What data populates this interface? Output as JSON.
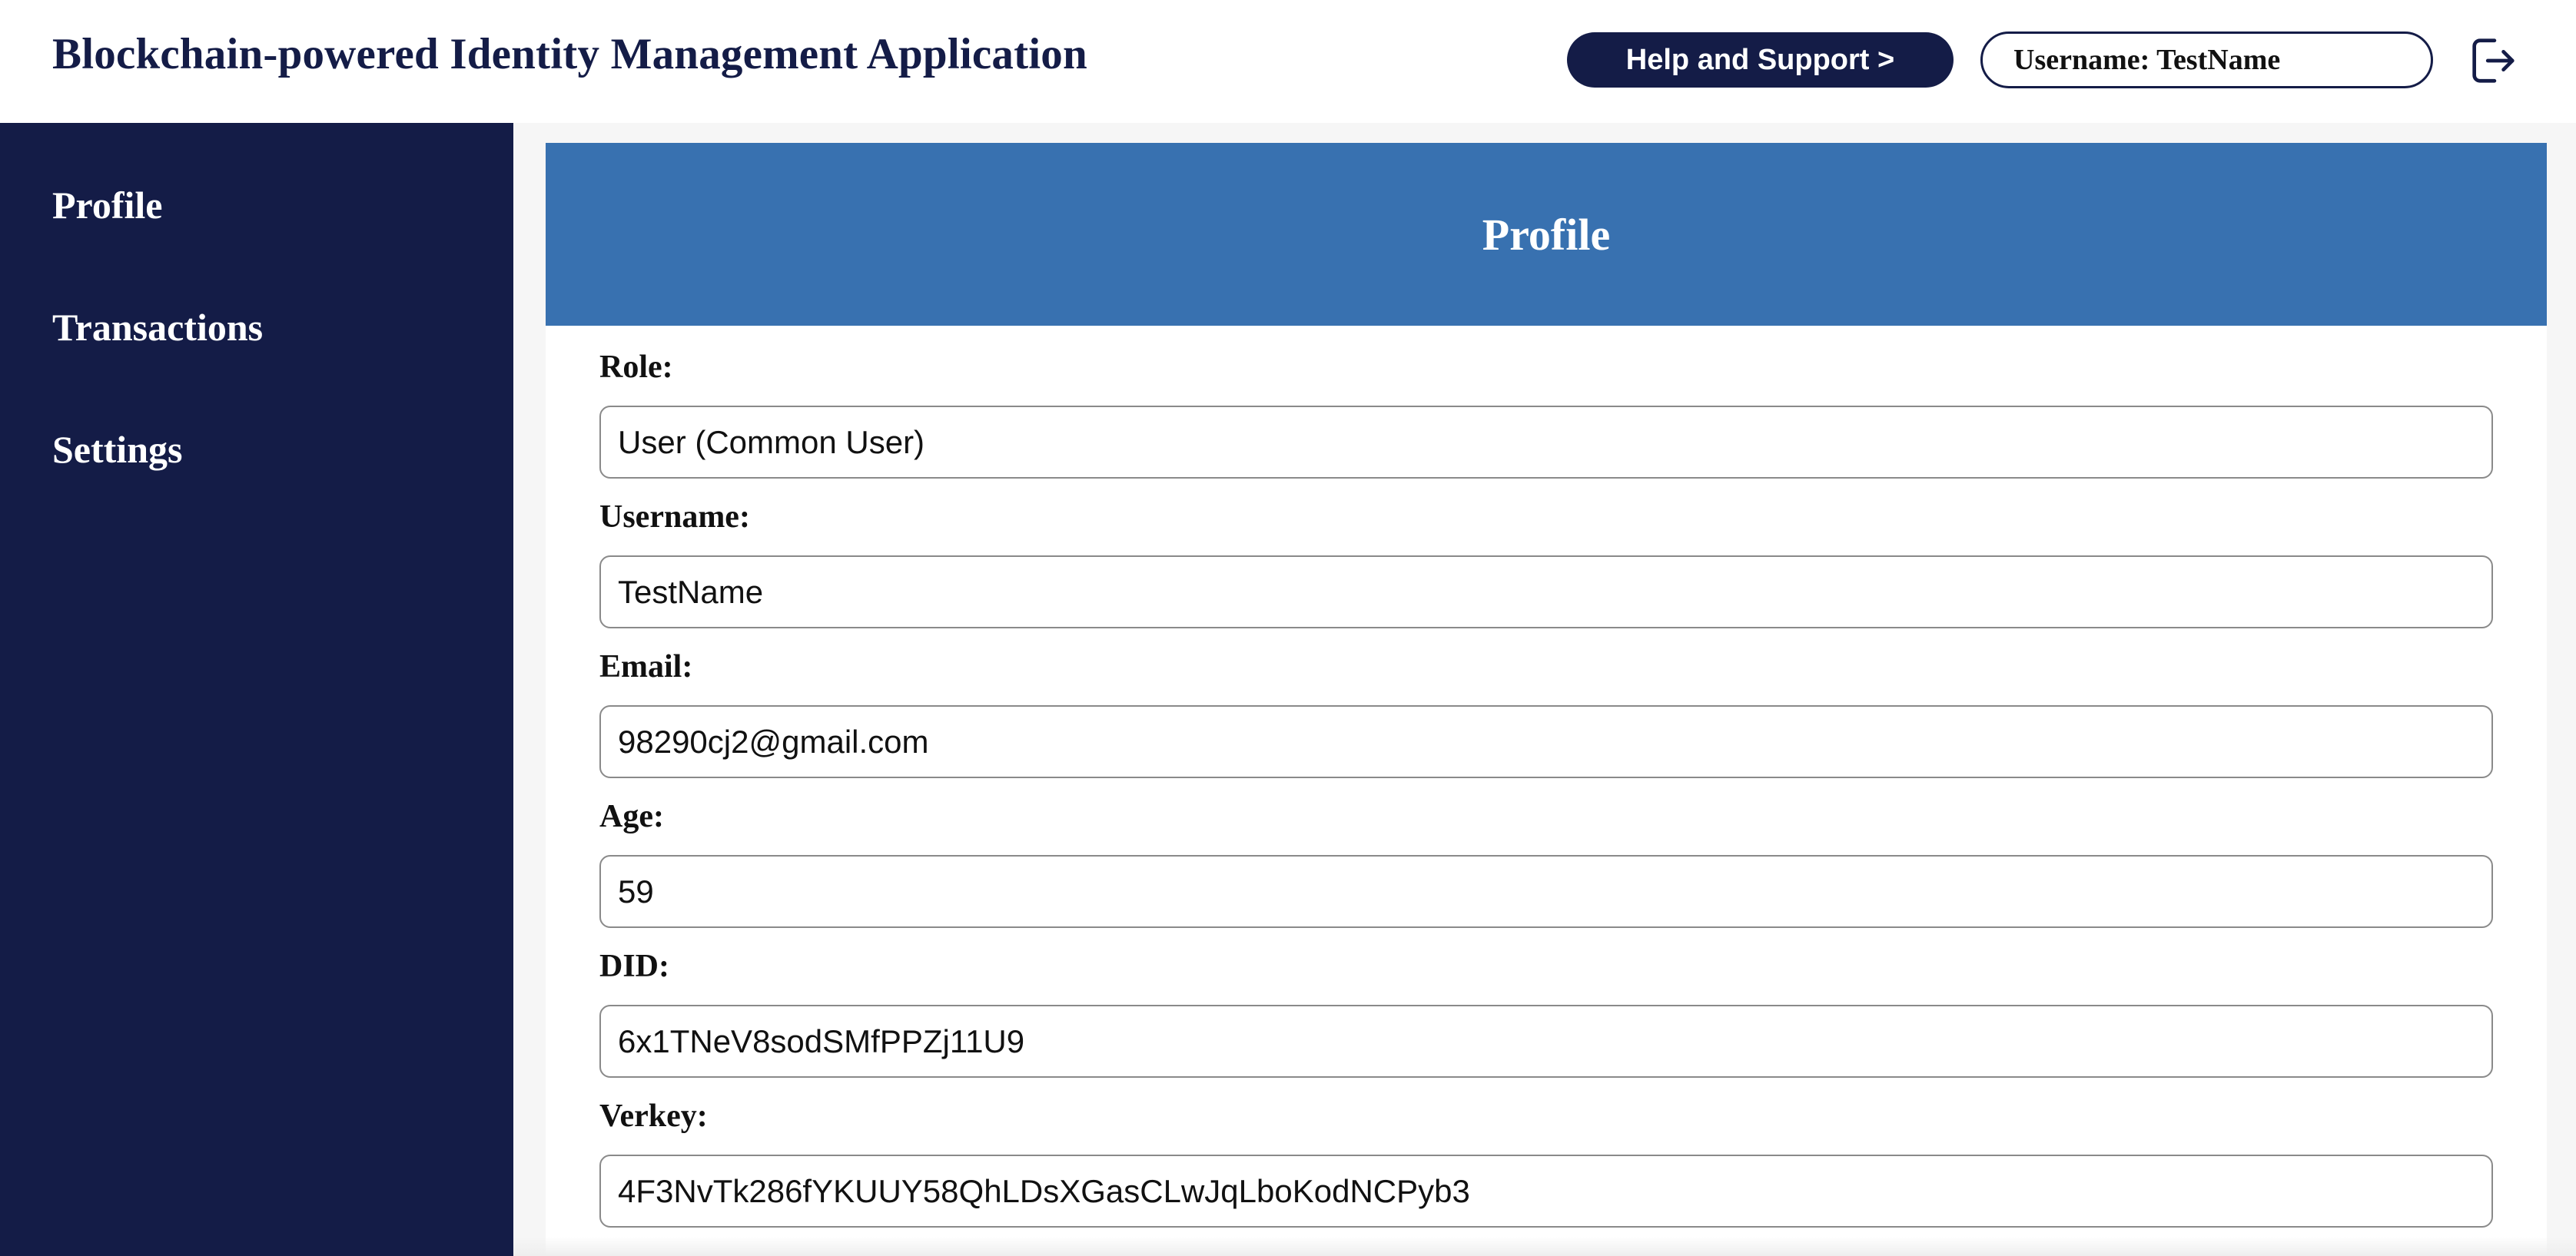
{
  "header": {
    "app_title": "Blockchain-powered Identity Management Application",
    "help_label": "Help and Support >",
    "username_display": "Username: TestName",
    "logout_icon": "logout-icon"
  },
  "sidebar": {
    "items": [
      {
        "label": "Profile"
      },
      {
        "label": "Transactions"
      },
      {
        "label": "Settings"
      }
    ]
  },
  "profile": {
    "title": "Profile",
    "fields": [
      {
        "label": "Role:",
        "value": "User (Common User)"
      },
      {
        "label": "Username:",
        "value": "TestName"
      },
      {
        "label": "Email:",
        "value": "98290cj2@gmail.com"
      },
      {
        "label": "Age:",
        "value": "59"
      },
      {
        "label": "DID:",
        "value": "6x1TNeV8sodSMfPPZj11U9"
      },
      {
        "label": "Verkey:",
        "value": "4F3NvTk286fYKUUY58QhLDsXGasCLwJqLboKodNCPyb3"
      }
    ]
  },
  "colors": {
    "navy": "#141c47",
    "profile_header_blue": "#3871b0"
  }
}
